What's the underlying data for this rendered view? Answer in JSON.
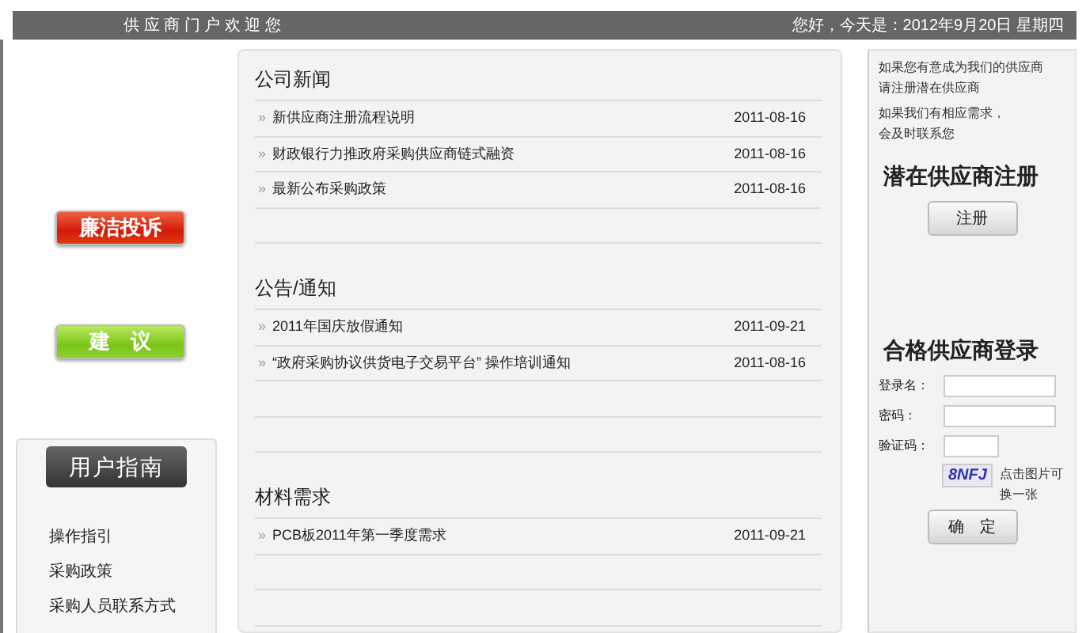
{
  "top_bar": {
    "welcome": "供 应 商 门 户 欢 迎 您",
    "greeting": "您好，今天是：2012年9月20日  星期四"
  },
  "side_buttons": [
    {
      "label": "廉洁投诉",
      "kind": "complaint"
    },
    {
      "label": "建　议",
      "kind": "suggestion"
    }
  ],
  "guide": {
    "title": "用户指南",
    "links": [
      "操作指引",
      "采购政策",
      "采购人员联系方式"
    ]
  },
  "sections": [
    {
      "title": "公司新闻",
      "items": [
        {
          "marker": "»",
          "title": "新供应商注册流程说明",
          "date": "2011-08-16"
        },
        {
          "marker": "»",
          "title": "财政银行力推政府采购供应商链式融资",
          "date": "2011-08-16"
        },
        {
          "marker": "»",
          "title": "最新公布采购政策",
          "date": "2011-08-16"
        }
      ]
    },
    {
      "title": "公告/通知",
      "items": [
        {
          "marker": "»",
          "title": "2011年国庆放假通知",
          "date": "2011-09-21"
        },
        {
          "marker": "»",
          "title": "“政府采购协议供货电子交易平台” 操作培训通知",
          "date": "2011-08-16"
        }
      ]
    },
    {
      "title": "材料需求",
      "items": [
        {
          "marker": "»",
          "title": "PCB板2011年第一季度需求",
          "date": "2011-09-21"
        }
      ]
    }
  ],
  "register": {
    "notes": [
      [
        "如果您有意成为我们的供应商",
        "请注册潜在供应商"
      ],
      [
        "如果我们有相应需求，",
        "会及时联系您"
      ]
    ],
    "heading": "潜在供应商注册",
    "button": "注册"
  },
  "login": {
    "heading": "合格供应商登录",
    "fields": [
      {
        "label": "登录名：",
        "kind": "wide"
      },
      {
        "label": "密码：",
        "kind": "wide"
      },
      {
        "label": "验证码：",
        "kind": "short"
      }
    ],
    "captcha": "8NFJ",
    "captcha_hint": "点击图片可换一张",
    "button": "确　定"
  }
}
